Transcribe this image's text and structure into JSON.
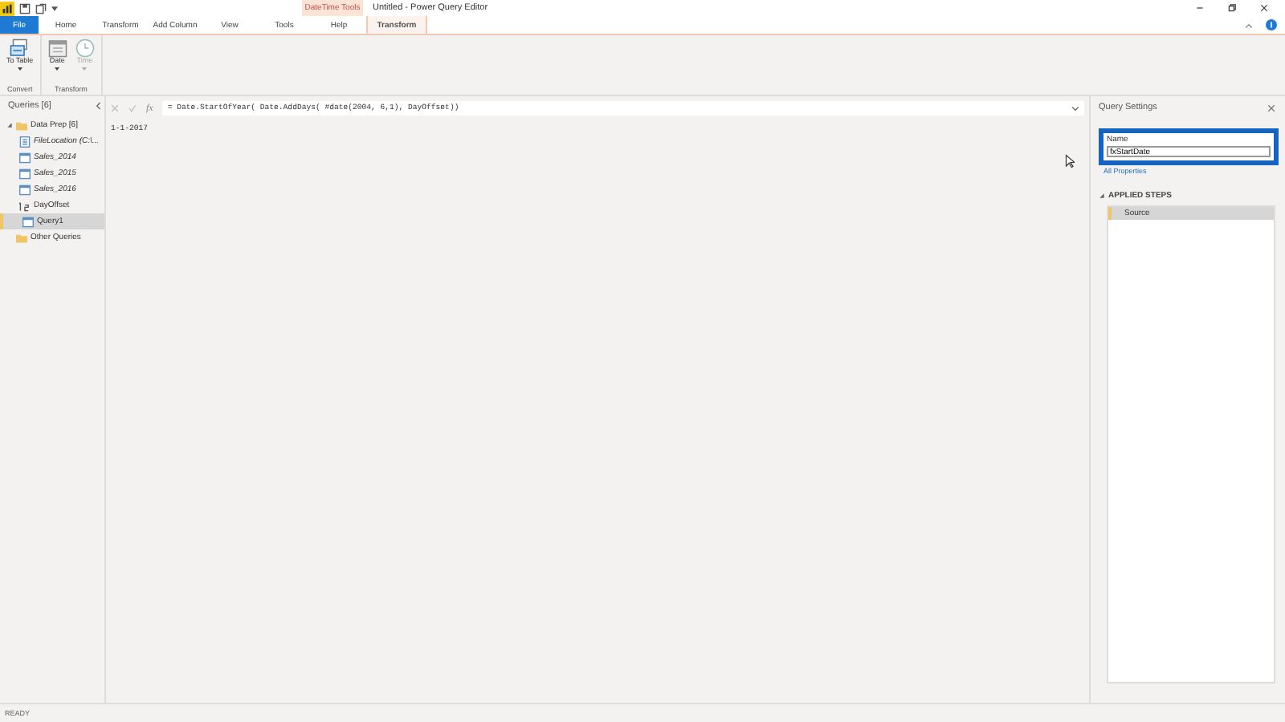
{
  "window": {
    "title": "Untitled - Power Query Editor",
    "context_group": "DateTime Tools"
  },
  "tabs": [
    {
      "label": "File",
      "kind": "file",
      "selected": false
    },
    {
      "label": "Home",
      "kind": "normal",
      "selected": false
    },
    {
      "label": "Transform",
      "kind": "normal",
      "selected": false
    },
    {
      "label": "Add Column",
      "kind": "normal",
      "selected": false
    },
    {
      "label": "View",
      "kind": "normal",
      "selected": false
    },
    {
      "label": "Tools",
      "kind": "normal",
      "selected": false
    },
    {
      "label": "Help",
      "kind": "normal",
      "selected": false
    },
    {
      "label": "Transform",
      "kind": "contextual",
      "selected": true
    }
  ],
  "ribbon": {
    "groups": [
      {
        "label": "Convert",
        "buttons": [
          {
            "label": "To Table",
            "kind": "table",
            "disabled": false,
            "dropdown": true
          }
        ]
      },
      {
        "label": "Transform",
        "buttons": [
          {
            "label": "Date",
            "kind": "calendar",
            "disabled": false,
            "dropdown": true
          },
          {
            "label": "Time",
            "kind": "clock",
            "disabled": true,
            "dropdown": true
          }
        ]
      }
    ]
  },
  "queries": {
    "title": "Queries [6]",
    "items": [
      {
        "label": "Data Prep [6]",
        "kind": "folder",
        "expanded": true,
        "selected": false,
        "children": [
          {
            "label": "FileLocation (C:\\...",
            "kind": "param",
            "italic": true,
            "selected": false
          },
          {
            "label": "Sales_2014",
            "kind": "table",
            "italic": true,
            "selected": false
          },
          {
            "label": "Sales_2015",
            "kind": "table",
            "italic": true,
            "selected": false
          },
          {
            "label": "Sales_2016",
            "kind": "table",
            "italic": true,
            "selected": false
          },
          {
            "label": "DayOffset",
            "kind": "number",
            "italic": false,
            "selected": false
          },
          {
            "label": "Query1",
            "kind": "table",
            "italic": false,
            "selected": true
          }
        ]
      },
      {
        "label": "Other Queries",
        "kind": "folder",
        "expanded": false,
        "selected": false
      }
    ]
  },
  "formula_bar": {
    "fx_label": "fx",
    "formula": "= Date.StartOfYear( Date.AddDays( #date(2004, 6,1), DayOffset))"
  },
  "result": {
    "value": "1-1-2017"
  },
  "query_settings": {
    "title": "Query Settings",
    "name_label": "Name",
    "name_value": "fxStartDate",
    "all_properties": "All Properties",
    "applied_steps_title": "APPLIED STEPS",
    "steps": [
      {
        "label": "Source",
        "selected": true
      }
    ]
  },
  "status_bar": {
    "text": "READY"
  }
}
